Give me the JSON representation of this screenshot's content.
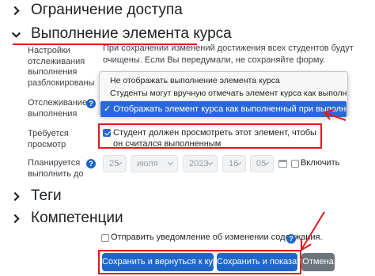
{
  "sections": {
    "access": "Ограничение доступа",
    "completion": "Выполнение элемента курса",
    "tags": "Теги",
    "competencies": "Компетенции"
  },
  "completion": {
    "unlock_label": "Настройки\nотслеживания\nвыполнения\nразблокированы",
    "warning": "При сохранении изменений достижения всех студентов будут очищены. Если Вы передумали, не сохраняйте форму.",
    "tracking_label": "Отслеживание\nвыполнения",
    "tracking_options": [
      "Не отображать выполнение элемента курса",
      "Студенты могут вручную отмечать элемент курса как выполненный.",
      "✓ Отображать элемент курса как выполненный при выполнении условий"
    ],
    "tracking_selected_index": 2,
    "require_view_label": "Требуется\nпросмотр",
    "require_view_text": "Студент должен просмотреть этот элемент, чтобы он считался выполненным",
    "require_view_checked": true,
    "expected_label": "Планируется\nвыполнить до",
    "date": {
      "day": "25",
      "month": "июля",
      "year": "2023",
      "hour": "16",
      "minute": "05"
    },
    "enable_label": "Включить",
    "enable_checked": false
  },
  "notify": {
    "text": "Отправить уведомление об изменении содержания.",
    "checked": false
  },
  "buttons": {
    "save_return": "Сохранить и вернуться к курсу",
    "save_display": "Сохранить и показать",
    "cancel": "Отмена"
  },
  "colors": {
    "accent": "#1e66c9",
    "highlight_red": "#e0191d",
    "secondary": "#6c757d"
  }
}
